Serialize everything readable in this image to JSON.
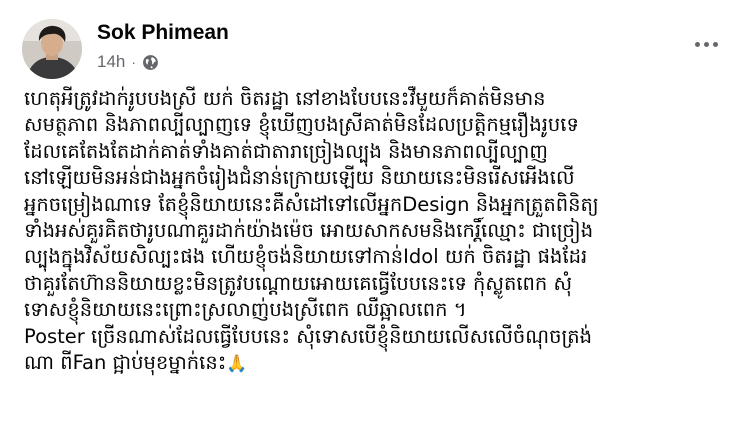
{
  "post": {
    "author": "Sok Phimean",
    "timestamp": "14h",
    "separator": "·",
    "privacy_icon": "globe-icon",
    "more_icon": "more-horizontal-icon",
    "emoji": "🙏",
    "body_lines": [
      "ហេតុអីត្រូវដាក់រូបបងស្រី យក់ ចិតរដ្ឋា នៅខាងបែបនេះវឺមួយក៏គាត់មិនមាន",
      "សមត្ថភាព និងភាពល្បីល្បាញទេ ខ្ញុំឃើញបងស្រីគាត់មិនដែលប្រត្តិកម្មរឿងរូបទេ",
      "ដែលគេតែងតែដាក់គាត់ទាំងគាត់ជាតារាច្រៀងល្បុង និងមានភាពល្បីល្បាញ",
      "នៅឡើយមិនអន់ជាងអ្នកចំរៀងជំនាន់ក្រោយឡើយ និយាយនេះមិនរើសអើងលើ",
      "អ្នកចម្រៀងណាទេ តែខ្ញុំនិយាយនេះគឺសំដៅទៅលើអ្នកDesign និងអ្នកត្រួតពិនិត្យ",
      "ទាំងអស់គួរគិតថារូបណាគួរដាក់យ៉ាងម៉េច អោយសាកសមនិងកេរ្តិ៍ឈ្មោះ ជាច្រៀង",
      "ល្បុងក្នុងវិស័យសិល្បះផង ហើយខ្ញុំចង់និយាយទៅកាន់Idol យក់ ចិតរដ្ឋា ផងដែរ",
      "ថាគួរតែហ៊ាននិយាយខ្លះមិនត្រូវបណ្តោយអោយគេធ្វើបែបនេះទេ កុំស្លូតពេក សុំ",
      "ទោសខ្ញុំនិយាយនេះព្រោះស្រលាញ់បងស្រីពេក ឈឺឆ្អាលពេក ។",
      "Poster ច្រើនណាស់ដែលធ្វើបែបនេះ សុំទោសបើខ្ញុំនិយាយលើសលើចំណុចត្រង់",
      "ណា ពីFan ជ្អាប់មុខម្នាក់នេះ"
    ]
  }
}
